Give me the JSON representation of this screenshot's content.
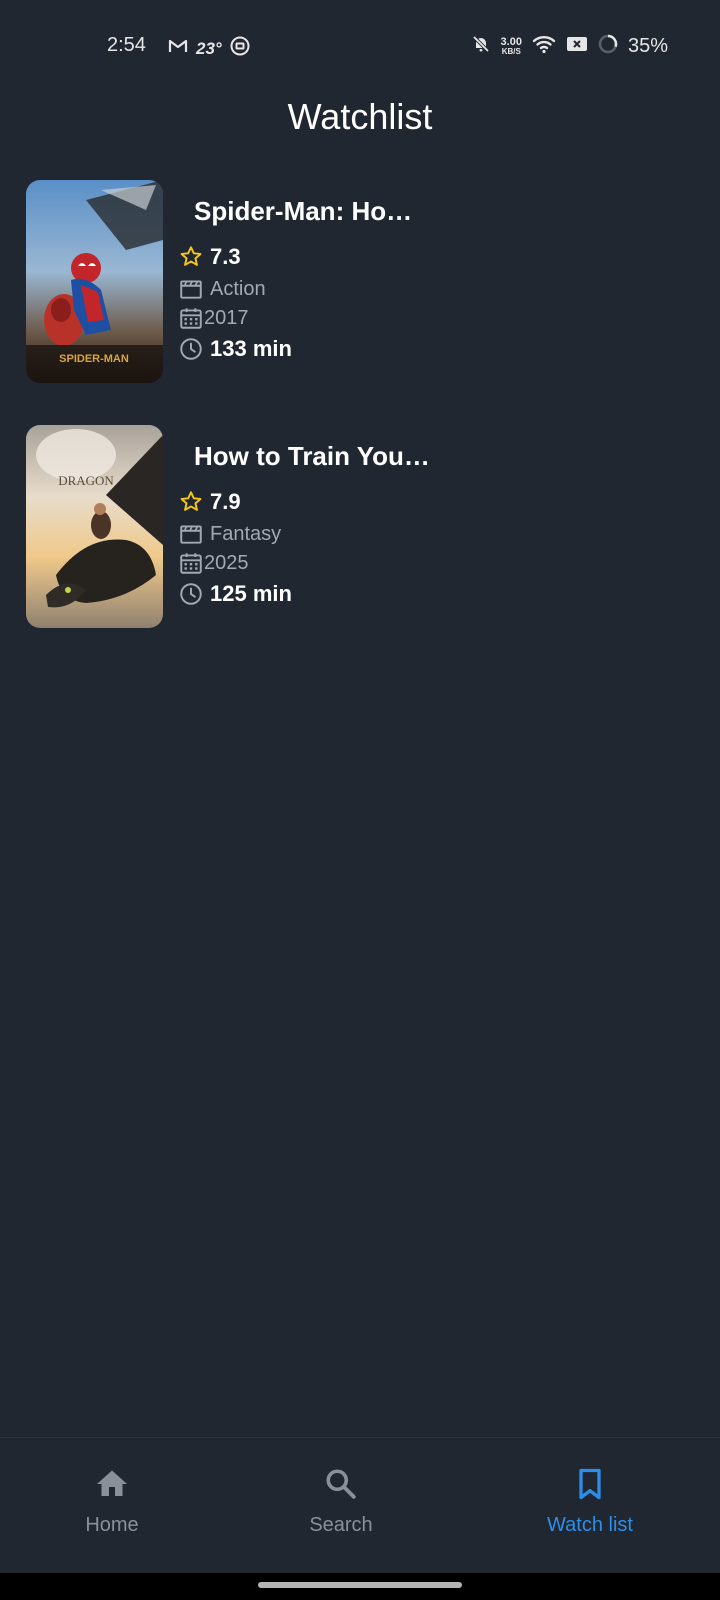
{
  "status_bar": {
    "time": "2:54",
    "temperature": "23°",
    "net_speed_value": "3.00",
    "net_speed_unit": "KB/S",
    "battery": "35%",
    "icons": [
      "gmail-icon",
      "temperature-icon",
      "app-notification-icon",
      "bell-off-icon",
      "wifi-icon",
      "sim-off-icon",
      "battery-ring-icon"
    ]
  },
  "header": {
    "title": "Watchlist"
  },
  "movies": [
    {
      "title": "Spider-Man: Ho…",
      "rating": "7.3",
      "genre": "Action",
      "year": "2017",
      "runtime": "133 min",
      "poster_caption": "SPIDER-MAN"
    },
    {
      "title": "How to Train You…",
      "rating": "7.9",
      "genre": "Fantasy",
      "year": "2025",
      "runtime": "125 min",
      "poster_caption": "DRAGON"
    }
  ],
  "bottom_nav": {
    "items": [
      {
        "label": "Home",
        "icon": "home-icon",
        "active": false
      },
      {
        "label": "Search",
        "icon": "search-icon",
        "active": false
      },
      {
        "label": "Watch list",
        "icon": "bookmark-icon",
        "active": true
      }
    ]
  },
  "colors": {
    "background": "#212731",
    "accent": "#2c8ee8",
    "star": "#f5c518",
    "muted_text": "#a3a9b3",
    "inactive_nav": "#8a9099"
  }
}
